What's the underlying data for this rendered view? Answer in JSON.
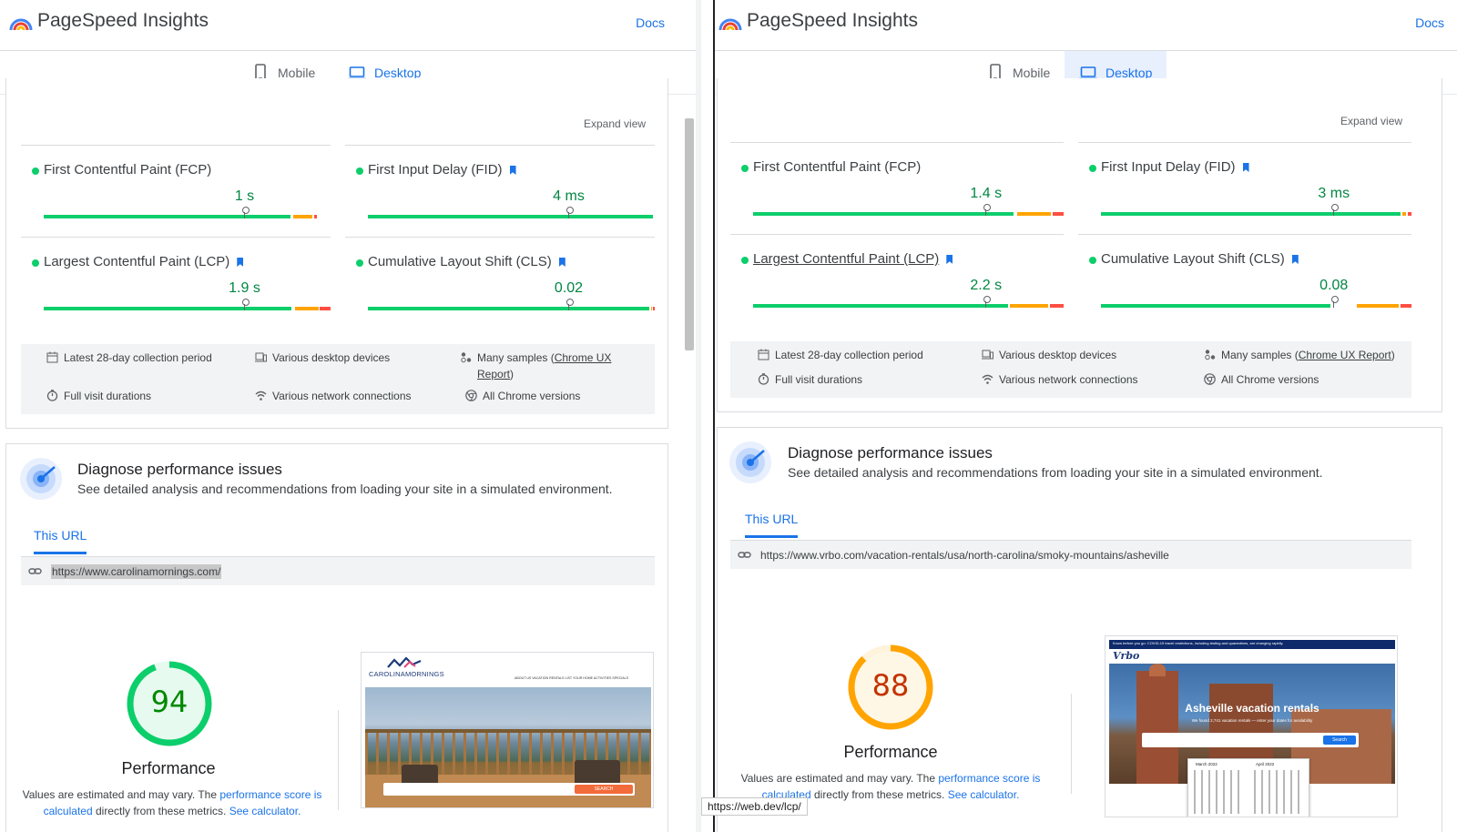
{
  "app_title": "PageSpeed Insights",
  "docs_label": "Docs",
  "tabs": {
    "mobile": "Mobile",
    "desktop": "Desktop"
  },
  "expand_view": "Expand view",
  "metric_names": {
    "fcp": "First Contentful Paint (FCP)",
    "fid": "First Input Delay (FID)",
    "lcp": "Largest Contentful Paint (LCP)",
    "cls": "Cumulative Layout Shift (CLS)"
  },
  "info_items": {
    "period": "Latest 28-day collection period",
    "devices": "Various desktop devices",
    "samples_prefix": "Many samples (",
    "samples_link": "Chrome UX Report",
    "samples_suffix": ")",
    "durations": "Full visit durations",
    "network": "Various network connections",
    "versions": "All Chrome versions"
  },
  "diagnose": {
    "title": "Diagnose performance issues",
    "subtitle": "See detailed analysis and recommendations from loading your site in a simulated environment.",
    "url_tab": "This URL",
    "performance_label": "Performance",
    "note_prefix": "Values are estimated and may vary. The ",
    "note_link1": "performance score is calculated",
    "note_middle": " directly from these metrics. ",
    "note_link2": "See calculator."
  },
  "left": {
    "url": "https://www.carolinamornings.com/",
    "score": "94",
    "score_fraction": 0.94,
    "score_color": "#0cce6b",
    "metrics": {
      "fcp": {
        "value": "1 s",
        "marker": 0.7
      },
      "fid": {
        "value": "4 ms",
        "marker": 0.7
      },
      "lcp": {
        "value": "1.9 s",
        "marker": 0.7
      },
      "cls": {
        "value": "0.02",
        "marker": 0.7
      }
    }
  },
  "right": {
    "url": "https://www.vrbo.com/vacation-rentals/usa/north-carolina/smoky-mountains/asheville",
    "score": "88",
    "score_fraction": 0.88,
    "score_color": "#ffa400",
    "metrics": {
      "fcp": {
        "value": "1.4 s",
        "marker": 0.75
      },
      "fid": {
        "value": "3 ms",
        "marker": 0.75
      },
      "lcp": {
        "value": "2.2 s",
        "marker": 0.75
      },
      "cls": {
        "value": "0.08",
        "marker": 0.75
      }
    }
  },
  "screenshots": {
    "carolina": {
      "brand_main": "CAROLINAMORNINGS",
      "nav": "ABOUT US   VACATION RENTALS   LIST YOUR HOME   ACTIVITIES   SPECIALS",
      "search_button": "SEARCH"
    },
    "vrbo": {
      "banner": "Know before you go: COVID-19 travel restrictions, including testing and quarantines, are changing rapidly.",
      "logo": "Vrbo",
      "headline": "Asheville vacation rentals",
      "subhead": "We found 2,741 vacation rentals — enter your dates for availability",
      "search_button": "Search",
      "month1": "March 2022",
      "month2": "April 2022"
    }
  },
  "status_url": "https://web.dev/lcp/",
  "colors": {
    "accent": "#1a73e8",
    "good": "#0cce6b",
    "average": "#ffa400",
    "poor": "#ff4e42"
  }
}
